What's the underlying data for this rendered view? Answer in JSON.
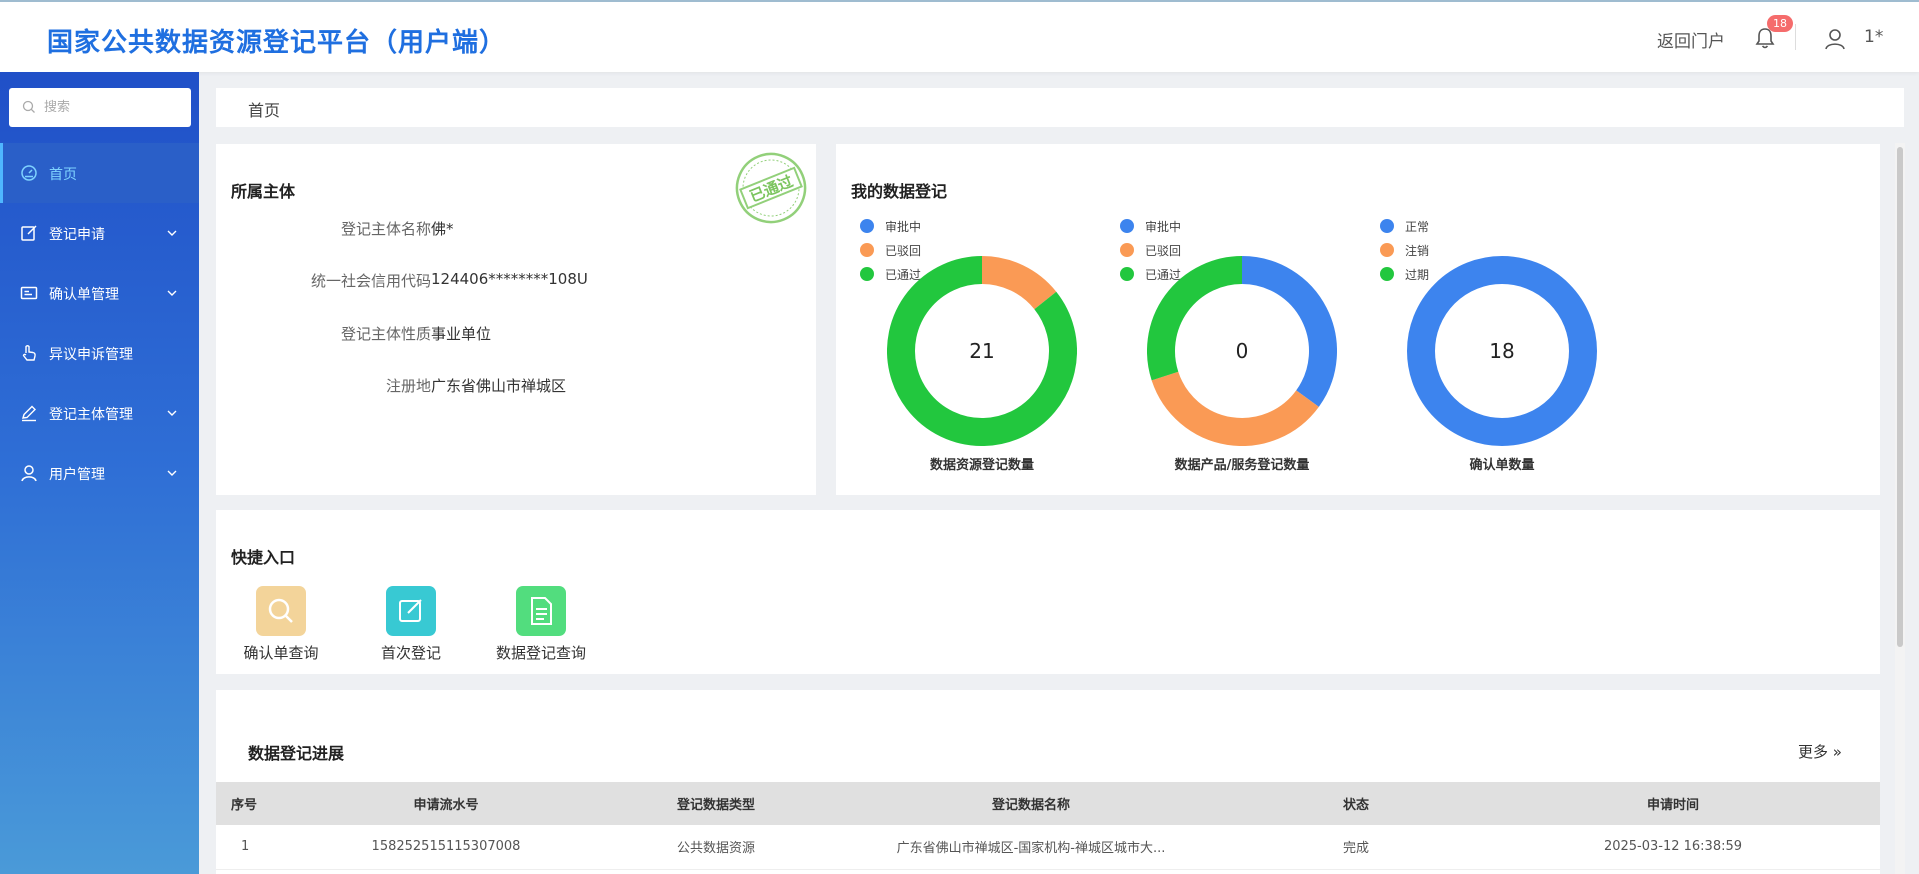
{
  "header": {
    "title": "国家公共数据资源登记平台（用户端）",
    "portal_link": "返回门户",
    "notification_count": "18",
    "user_name": "1*"
  },
  "sidebar": {
    "search_placeholder": "搜索",
    "items": [
      {
        "label": "首页",
        "icon": "dashboard-icon"
      },
      {
        "label": "登记申请",
        "icon": "edit-icon"
      },
      {
        "label": "确认单管理",
        "icon": "id-card-icon"
      },
      {
        "label": "异议申诉管理",
        "icon": "hand-pointer-icon"
      },
      {
        "label": "登记主体管理",
        "icon": "pen-icon"
      },
      {
        "label": "用户管理",
        "icon": "user-icon"
      }
    ]
  },
  "breadcrumb": "首页",
  "subject": {
    "title": "所属主体",
    "stamp_text": "已通过",
    "rows": [
      {
        "label": "登记主体名称",
        "value": "佛*"
      },
      {
        "label": "统一社会信用代码",
        "value": "124406********108U"
      },
      {
        "label": "登记主体性质",
        "value": "事业单位"
      },
      {
        "label": "注册地",
        "value": "广东省佛山市禅城区"
      }
    ]
  },
  "my_registration": {
    "title": "我的数据登记",
    "colors": {
      "blue": "#3d84ee",
      "orange": "#fa9a55",
      "green": "#22c73e"
    }
  },
  "chart_data": [
    {
      "type": "pie",
      "title": "数据资源登记数量",
      "total": "21",
      "categories": [
        "审批中",
        "已驳回",
        "已通过"
      ],
      "values": [
        0,
        3,
        18
      ],
      "colors": [
        "#3d84ee",
        "#fa9a55",
        "#22c73e"
      ]
    },
    {
      "type": "pie",
      "title": "数据产品/服务登记数量",
      "total": "0",
      "categories": [
        "审批中",
        "已驳回",
        "已通过"
      ],
      "values": [
        0.35,
        0.35,
        0.3
      ],
      "colors": [
        "#3d84ee",
        "#fa9a55",
        "#22c73e"
      ]
    },
    {
      "type": "pie",
      "title": "确认单数量",
      "total": "18",
      "categories": [
        "正常",
        "注销",
        "过期"
      ],
      "values": [
        18,
        0,
        0
      ],
      "colors": [
        "#3d84ee",
        "#fa9a55",
        "#22c73e"
      ]
    }
  ],
  "quick_entry": {
    "title": "快捷入口",
    "items": [
      {
        "label": "确认单查询",
        "icon": "search-icon",
        "color": "#f3d49a"
      },
      {
        "label": "首次登记",
        "icon": "edit-icon",
        "color": "#38c9d3"
      },
      {
        "label": "数据登记查询",
        "icon": "document-icon",
        "color": "#52dd7e"
      }
    ]
  },
  "progress": {
    "title": "数据登记进展",
    "more": "更多",
    "columns": [
      "序号",
      "申请流水号",
      "登记数据类型",
      "登记数据名称",
      "状态",
      "申请时间"
    ],
    "rows": [
      [
        "1",
        "158252515115307008",
        "公共数据资源",
        "广东省佛山市禅城区-国家机构-禅城区城市大...",
        "完成",
        "2025-03-12 16:38:59"
      ]
    ]
  }
}
